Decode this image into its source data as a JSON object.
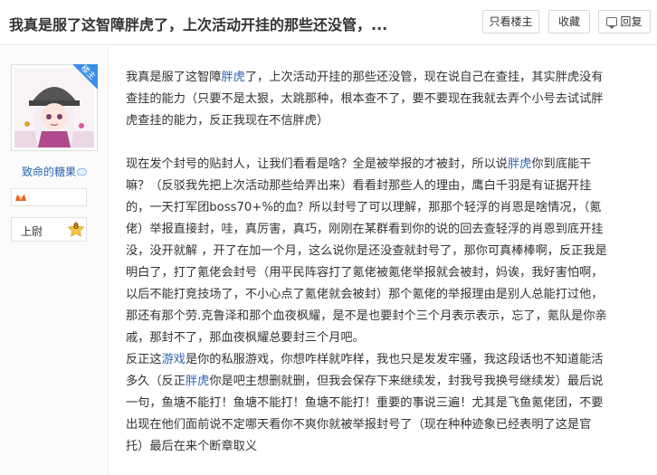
{
  "header": {
    "title": "我真是服了这智障胖虎了，上次活动开挂的那些还没管，...",
    "buttons": {
      "only_host": "只看楼主",
      "favorite": "收藏",
      "reply": "回复"
    }
  },
  "author": {
    "badge": "楼主",
    "name": "致命的糖果",
    "level_title": "上尉",
    "level": "8"
  },
  "post": {
    "p1": [
      [
        {
          "t": "我真是服了这智障"
        },
        {
          "t": "胖虎",
          "link": true
        },
        {
          "t": "了，上次活动开挂的那些还没管，现在说自己在查挂，其实胖虎没有"
        }
      ],
      [
        {
          "t": "查挂的能力（只要不是太狠，太跳那种，根本查不了，要不要现在我就去弄个小号去试试胖"
        }
      ],
      [
        {
          "t": "虎查挂的能力，反正我现在不信胖虎）"
        }
      ]
    ],
    "p2": [
      [
        {
          "t": "现在发个封号的贴封人，让我们看看是啥？全是被举报的才被封，所以说"
        },
        {
          "t": "胖虎",
          "link": true
        },
        {
          "t": "你到底能干"
        }
      ],
      [
        {
          "t": "嘛？（反驳我先把上次活动那些给弄出来）看看封那些人的理由，鹰白千羽是有证据开挂"
        }
      ],
      [
        {
          "t": "的，一天打军团boss70+%的血？所以封号了可以理解，那那个轻浮的肖恩是啥情况，（氪"
        }
      ],
      [
        {
          "t": "佬）举报直接封，哇，真厉害，真巧，刚刚在某群看到你的说的回去查轻浮的肖恩到底开挂"
        }
      ],
      [
        {
          "t": "没，没开就解 ，开了在加一个月，这么说你是还没查就封号了，那你可真棒棒啊，反正我是"
        }
      ],
      [
        {
          "t": "明白了，打了氪佬会封号（用平民阵容打了氪佬被氪佬举报就会被封，妈诶，我好害怕啊，"
        }
      ],
      [
        {
          "t": "以后不能打竞技场了，不小心点了氪佬就会被封）那个氪佬的举报理由是别人总能打过他，"
        }
      ],
      [
        {
          "t": "那还有那个劳.克鲁泽和那个血夜枫耀，是不是也要封个三个月表示表示，忘了，氪队是你亲"
        }
      ],
      [
        {
          "t": "戚，那封不了，那血夜枫耀总要封三个月吧。"
        }
      ],
      [
        {
          "t": "反正这"
        },
        {
          "t": "游戏",
          "link": true
        },
        {
          "t": "是你的私服游戏，你想咋样就咋样，我也只是发发牢骚，我这段话也不知道能活"
        }
      ],
      [
        {
          "t": "多久（反正"
        },
        {
          "t": "胖虎",
          "link": true
        },
        {
          "t": "你是吧主想删就删，但我会保存下来继续发，封我号我换号继续发）最后说"
        }
      ],
      [
        {
          "t": "一句，鱼塘不能打！鱼塘不能打！鱼塘不能打！重要的事说三遍！尤其是飞鱼氪佬团，不要"
        }
      ],
      [
        {
          "t": "出现在他们面前说不定哪天看你不爽你就被举报封号了（现在种种迹象已经表明了这是官"
        }
      ],
      [
        {
          "t": "托）最后在来个断章取义"
        }
      ]
    ]
  },
  "colors": {
    "link": "#2d64b3",
    "badge": "#3a8ee6",
    "text": "#333333"
  },
  "icons": [
    "host-badge",
    "vip-icon",
    "medal-icon",
    "level-badge-icon",
    "reply-icon"
  ]
}
